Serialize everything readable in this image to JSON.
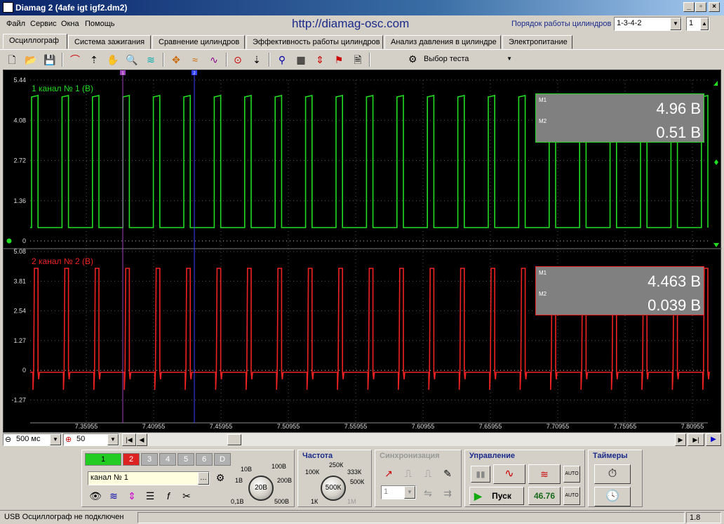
{
  "window": {
    "title": "Diamag 2 (4afe igt igf2.dm2)"
  },
  "menu": [
    "Файл",
    "Сервис",
    "Окна",
    "Помощь"
  ],
  "url": "http://diamag-osc.com",
  "cylinder_order": {
    "label": "Порядок работы цилиндров",
    "value": "1-3-4-2",
    "cylinder": "1"
  },
  "tabs": [
    "Осциллограф",
    "Система зажигания",
    "Сравнение цилиндров",
    "Эффективность работы цилиндров",
    "Анализ давления в цилиндре",
    "Электропитание"
  ],
  "active_tab": 0,
  "toolbar": {
    "test_select": "Выбор теста"
  },
  "scope": {
    "channel1": {
      "label": "1  канал № 1 (В)",
      "color": "#22dd22",
      "y_ticks": [
        "5.44",
        "4.08",
        "2.72",
        "1.36",
        "0"
      ],
      "m1": "4.96 В",
      "m2": "0.51 В"
    },
    "channel2": {
      "label": "2  канал № 2 (В)",
      "color": "#ee2222",
      "y_ticks": [
        "5.08",
        "3.81",
        "2.54",
        "1.27",
        "0",
        "-1.27"
      ],
      "m1": "4.463 В",
      "m2": "0.039 В"
    },
    "x_ticks": [
      "7.35955",
      "7.40955",
      "7.45955",
      "7.50955",
      "7.55955",
      "7.60955",
      "7.65955",
      "7.70955",
      "7.75955",
      "7.80955"
    ],
    "markers": [
      "1",
      "2"
    ],
    "readout_labels": {
      "m1": "M1",
      "m2": "M2"
    }
  },
  "bottom": {
    "timebase": "500 мс",
    "points": "50"
  },
  "panel": {
    "channels": [
      "1",
      "2",
      "3",
      "4",
      "5",
      "6",
      "D"
    ],
    "channel_name": "канал № 1",
    "amplitude": {
      "value": "20В",
      "ticks": [
        "10В",
        "100В",
        "1В",
        "200В",
        "0,1В",
        "500В"
      ]
    },
    "frequency": {
      "title": "Частота",
      "value": "500К",
      "ticks": [
        "250К",
        "100К",
        "333К",
        "500К",
        "1К",
        "1М"
      ]
    },
    "sync": {
      "title": "Синхронизация",
      "value": "1"
    },
    "control": {
      "title": "Управление",
      "start": "Пуск",
      "fps": "46.76",
      "auto": "AUTO"
    },
    "timers": {
      "title": "Таймеры"
    }
  },
  "status": {
    "text": "USB Осциллограф не подключен",
    "version": "1.8"
  }
}
